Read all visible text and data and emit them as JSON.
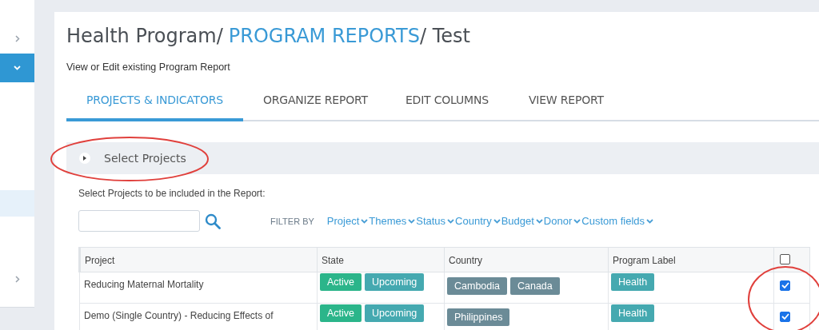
{
  "sidebar": {
    "items": [
      {
        "kind": "group",
        "expanded": false,
        "selected": false
      },
      {
        "kind": "group",
        "expanded": true,
        "selected": true
      },
      {
        "kind": "link",
        "selected": true
      },
      {
        "kind": "group",
        "expanded": false,
        "selected": false
      }
    ]
  },
  "breadcrumb": {
    "root": "Health Program/",
    "link": "PROGRAM REPORTS",
    "current": "/ Test"
  },
  "subtitle": "View or Edit existing Program Report",
  "tabs": [
    {
      "label": "PROJECTS & INDICATORS",
      "selected": true
    },
    {
      "label": "ORGANIZE REPORT",
      "selected": false
    },
    {
      "label": "EDIT COLUMNS",
      "selected": false
    },
    {
      "label": "VIEW REPORT",
      "selected": false
    }
  ],
  "section": {
    "title": "Select Projects",
    "expanded": false
  },
  "instructions": "Select Projects to be included in the Report:",
  "filter": {
    "label": "FILTER BY",
    "options": [
      "Project",
      "Themes",
      "Status",
      "Country",
      "Budget",
      "Donor",
      "Custom fields"
    ]
  },
  "table": {
    "columns": [
      "Project",
      "State",
      "Country",
      "Program Label"
    ],
    "select_all": {
      "checked": false
    },
    "rows": [
      {
        "project": "Reducing Maternal Mortality",
        "states": [
          {
            "label": "Active",
            "color": "#2bb58a"
          },
          {
            "label": "Upcoming",
            "color": "#45a9b0"
          }
        ],
        "countries": [
          "Cambodia",
          "Canada"
        ],
        "labels": [
          "Health"
        ],
        "checked": true
      },
      {
        "project": "Demo (Single Country) - Reducing Effects of",
        "states": [
          {
            "label": "Active",
            "color": "#2bb58a"
          },
          {
            "label": "Upcoming",
            "color": "#45a9b0"
          }
        ],
        "countries": [
          "Philippines"
        ],
        "labels": [
          "Health"
        ],
        "checked": true
      }
    ]
  }
}
